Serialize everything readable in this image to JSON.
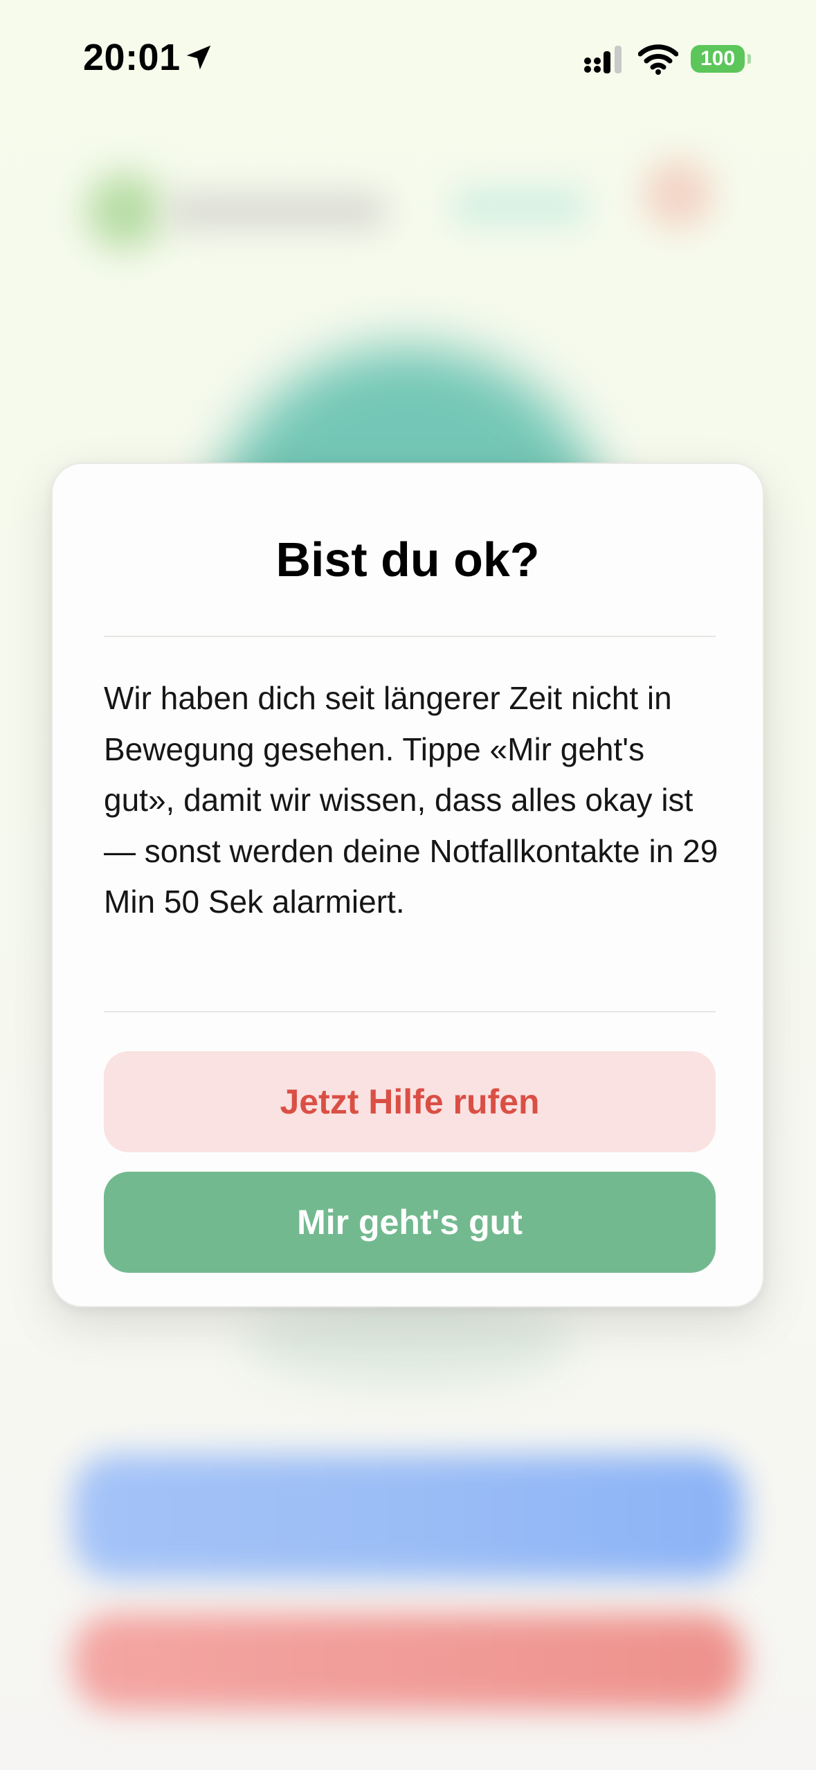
{
  "status_bar": {
    "time": "20:01",
    "battery": "100",
    "icons": [
      "location-arrow-icon",
      "cellular-signal-icon",
      "wifi-icon",
      "battery-icon"
    ]
  },
  "dialog": {
    "title": "Bist du ok?",
    "message": "Wir haben dich seit längerer Zeit nicht in Bewegung gesehen. Tippe «Mir geht's gut», damit wir wissen, dass alles okay ist — sonst werden deine Notfallkontakte in 29 Min 50 Sek alarmiert.",
    "help_button": "Jetzt Hilfe rufen",
    "ok_button": "Mir geht's gut"
  },
  "colors": {
    "help_button_bg": "#f9e2e1",
    "help_button_text": "#da4f45",
    "ok_button_bg": "#73b98f",
    "battery": "#5cc65a"
  }
}
